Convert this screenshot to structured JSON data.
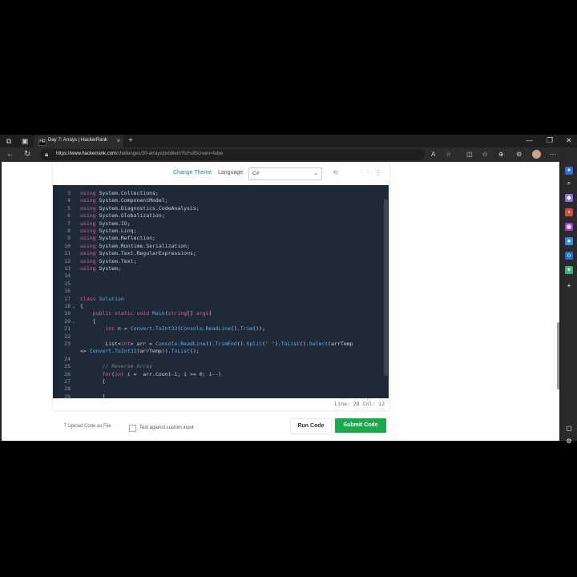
{
  "browser": {
    "tab_title": "Day 7: Arrays | HackerRank",
    "tab_favicon": "HR",
    "url_host": "https://www.hackerrank.com",
    "url_path": "/challenges/30-arrays/problem?isFullScreen=false"
  },
  "toolbar": {
    "change_theme": "Change Theme",
    "language_label": "Language",
    "language_value": "C#"
  },
  "editor": {
    "lines": [
      {
        "n": "3",
        "tokens": [
          [
            "kw",
            "using"
          ],
          [
            "ty",
            " System.Collections;"
          ]
        ]
      },
      {
        "n": "4",
        "tokens": [
          [
            "kw",
            "using"
          ],
          [
            "ty",
            " System.ComponentModel;"
          ]
        ]
      },
      {
        "n": "5",
        "tokens": [
          [
            "kw",
            "using"
          ],
          [
            "ty",
            " System.Diagnostics.CodeAnalysis;"
          ]
        ]
      },
      {
        "n": "6",
        "tokens": [
          [
            "kw",
            "using"
          ],
          [
            "ty",
            " System.Globalization;"
          ]
        ]
      },
      {
        "n": "7",
        "tokens": [
          [
            "kw",
            "using"
          ],
          [
            "ty",
            " System.IO;"
          ]
        ]
      },
      {
        "n": "8",
        "tokens": [
          [
            "kw",
            "using"
          ],
          [
            "ty",
            " System.Linq;"
          ]
        ]
      },
      {
        "n": "9",
        "tokens": [
          [
            "kw",
            "using"
          ],
          [
            "ty",
            " System.Reflection;"
          ]
        ]
      },
      {
        "n": "10",
        "tokens": [
          [
            "kw",
            "using"
          ],
          [
            "ty",
            " System.Runtime.Serialization;"
          ]
        ]
      },
      {
        "n": "11",
        "tokens": [
          [
            "kw",
            "using"
          ],
          [
            "ty",
            " System.Text.RegularExpressions;"
          ]
        ]
      },
      {
        "n": "12",
        "tokens": [
          [
            "kw",
            "using"
          ],
          [
            "ty",
            " System.Text;"
          ]
        ]
      },
      {
        "n": "13",
        "tokens": [
          [
            "kw",
            "using"
          ],
          [
            "ty",
            " System;"
          ]
        ]
      },
      {
        "n": "14",
        "tokens": []
      },
      {
        "n": "15",
        "tokens": []
      },
      {
        "n": "16",
        "tokens": []
      },
      {
        "n": "17",
        "tokens": [
          [
            "kw",
            "class"
          ],
          [
            "ty",
            " "
          ],
          [
            "cls",
            "Solution"
          ]
        ]
      },
      {
        "n": "18",
        "fold": "v",
        "tokens": [
          [
            "ty",
            "{"
          ]
        ]
      },
      {
        "n": "19",
        "tokens": [
          [
            "ty",
            "    "
          ],
          [
            "kw",
            "public static void"
          ],
          [
            "ty",
            " "
          ],
          [
            "fn",
            "Main"
          ],
          [
            "ty",
            "("
          ],
          [
            "kw",
            "string"
          ],
          [
            "ty",
            "[] "
          ],
          [
            "kw",
            "args"
          ],
          [
            "ty",
            ")"
          ]
        ]
      },
      {
        "n": "20",
        "fold": "v",
        "tokens": [
          [
            "ty",
            "    {"
          ]
        ]
      },
      {
        "n": "21",
        "tokens": [
          [
            "ty",
            "        "
          ],
          [
            "kw",
            "int"
          ],
          [
            "ty",
            " n = "
          ],
          [
            "fn",
            "Convert"
          ],
          [
            "ty",
            "."
          ],
          [
            "fn",
            "ToInt32"
          ],
          [
            "ty",
            "("
          ],
          [
            "fn",
            "Console"
          ],
          [
            "ty",
            "."
          ],
          [
            "fn",
            "ReadLine"
          ],
          [
            "ty",
            "()."
          ],
          [
            "fn",
            "Trim"
          ],
          [
            "ty",
            "());"
          ]
        ]
      },
      {
        "n": "22",
        "tokens": []
      },
      {
        "n": "23",
        "tokens": [
          [
            "ty",
            "        List<"
          ],
          [
            "kw",
            "int"
          ],
          [
            "ty",
            "> arr = "
          ],
          [
            "fn",
            "Console"
          ],
          [
            "ty",
            "."
          ],
          [
            "fn",
            "ReadLine"
          ],
          [
            "ty",
            "()."
          ],
          [
            "fn",
            "TrimEnd"
          ],
          [
            "ty",
            "()."
          ],
          [
            "fn",
            "Split"
          ],
          [
            "ty",
            "(' ')."
          ],
          [
            "fn",
            "ToList"
          ],
          [
            "ty",
            "()."
          ],
          [
            "fn",
            "Select"
          ],
          [
            "ty",
            "(arrTemp"
          ]
        ]
      },
      {
        "n": "",
        "tokens": [
          [
            "ty",
            "=> "
          ],
          [
            "fn",
            "Convert"
          ],
          [
            "ty",
            "."
          ],
          [
            "fn",
            "ToInt32"
          ],
          [
            "ty",
            "(arrTemp))."
          ],
          [
            "fn",
            "ToList"
          ],
          [
            "ty",
            "();"
          ]
        ]
      },
      {
        "n": "24",
        "tokens": []
      },
      {
        "n": "25",
        "tokens": [
          [
            "ty",
            "       "
          ],
          [
            "cm",
            "// Reverse Array"
          ]
        ]
      },
      {
        "n": "26",
        "tokens": [
          [
            "ty",
            "       "
          ],
          [
            "kw",
            "for"
          ],
          [
            "ty",
            "("
          ],
          [
            "kw",
            "int"
          ],
          [
            "ty",
            " i =  arr.Count-1; i >= 0; i--)"
          ]
        ]
      },
      {
        "n": "27",
        "tokens": [
          [
            "ty",
            "       {"
          ]
        ]
      },
      {
        "n": "28",
        "tokens": []
      },
      {
        "n": "29",
        "tokens": [
          [
            "ty",
            "       }"
          ]
        ]
      }
    ]
  },
  "status": {
    "cursor": "Line: 28 Col: 12"
  },
  "actions": {
    "upload": "Upload Code as File",
    "custom_input": "Test against custom input",
    "run": "Run Code",
    "submit": "Submit Code"
  }
}
